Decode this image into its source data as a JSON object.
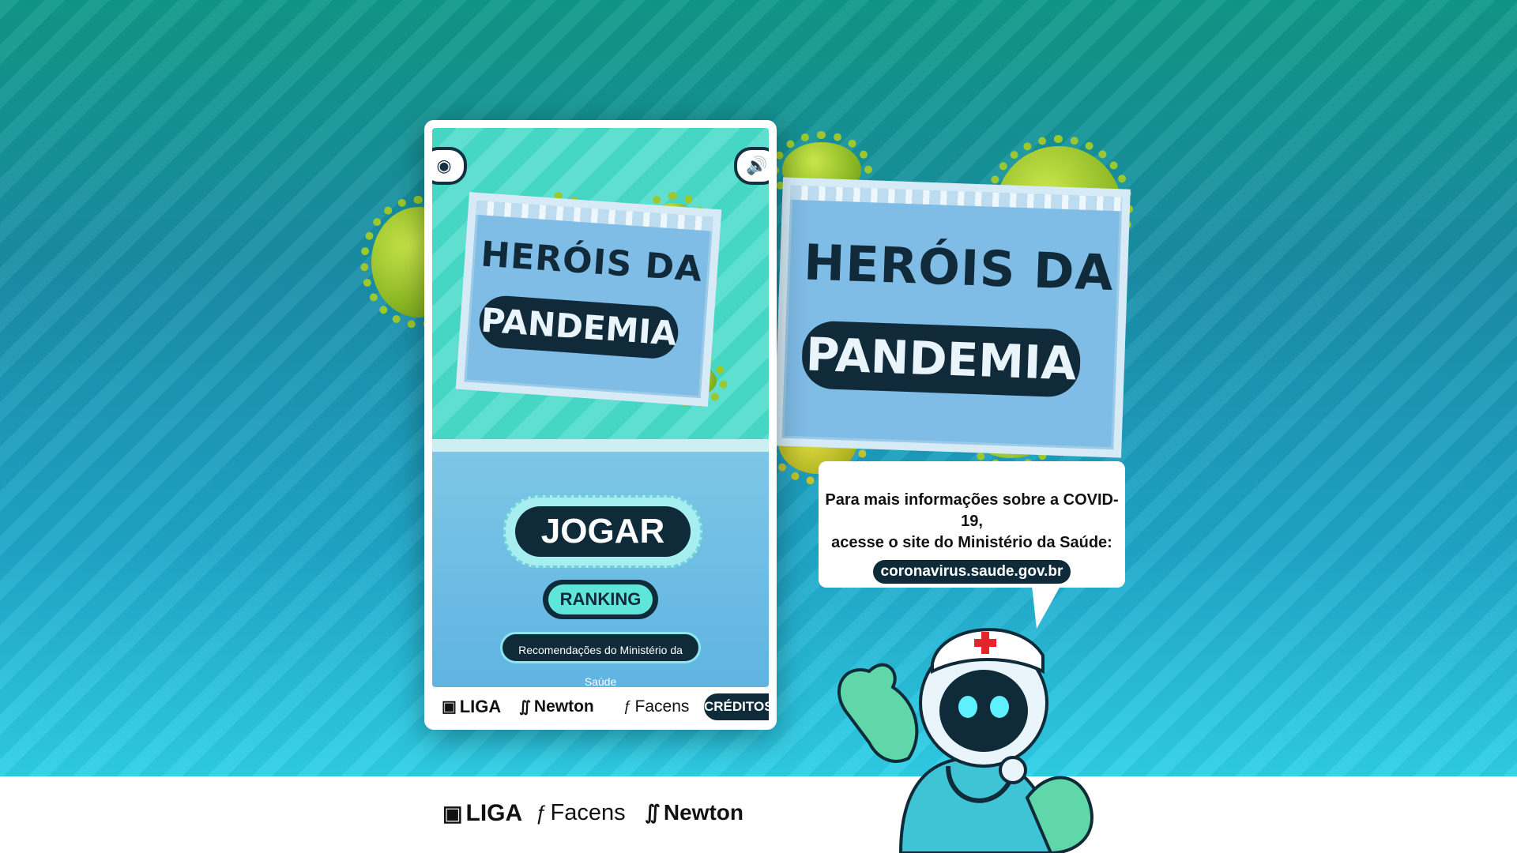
{
  "game": {
    "title_line1": "HERÓIS DA",
    "title_line2": "PANDEMIA"
  },
  "phone": {
    "camera_icon": "camera-icon",
    "sound_icon": "speaker-icon",
    "play_label": "JOGAR",
    "ranking_label": "RANKING",
    "recommendations_label": "Recomendações do Ministério da Saúde",
    "footer_logos": [
      "LIGA",
      "Newton",
      "Facens"
    ],
    "credits_label": "CRÉDITOS"
  },
  "info": {
    "line1": "Para mais informações sobre a COVID-19,",
    "line2": "acesse o site do Ministério da Saúde:",
    "url": "coronavirus.saude.gov.br"
  },
  "page_footer": {
    "logos": [
      "LIGA",
      "Facens",
      "Newton"
    ]
  },
  "colors": {
    "dark_navy": "#0f2a38",
    "teal": "#5fe5da",
    "virus_green": "#8cb825"
  }
}
